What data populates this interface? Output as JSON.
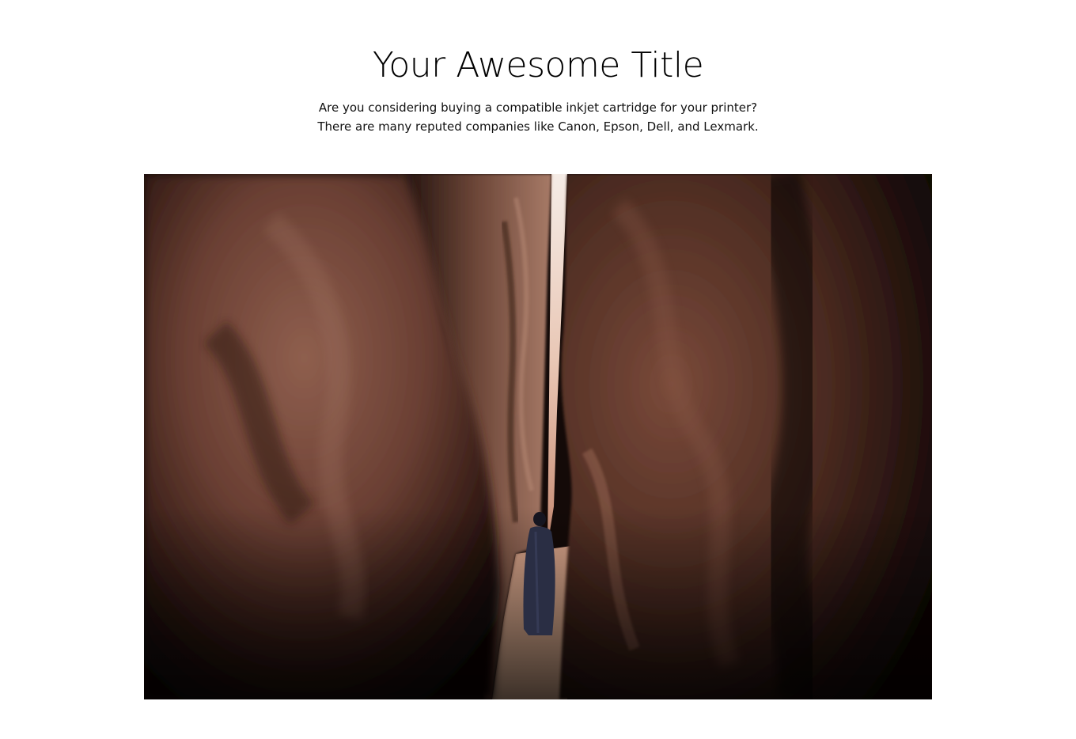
{
  "header": {
    "title": "Your Awesome Title",
    "subtitle_lines": [
      "Are you considering buying a compatible inkjet cartridge for your printer?",
      "There are many reputed companies like Canon, Epson, Dell, and Lexmark."
    ]
  },
  "hero_image": {
    "subject": "person in a long robe walking through a narrow sandstone slot canyon",
    "colors": {
      "rock_light": "#8a5a49",
      "rock_dark": "#1a0d0a",
      "sky": "#f3e6dd",
      "sand": "#e6b08f",
      "robe": "#2a2e44"
    }
  }
}
